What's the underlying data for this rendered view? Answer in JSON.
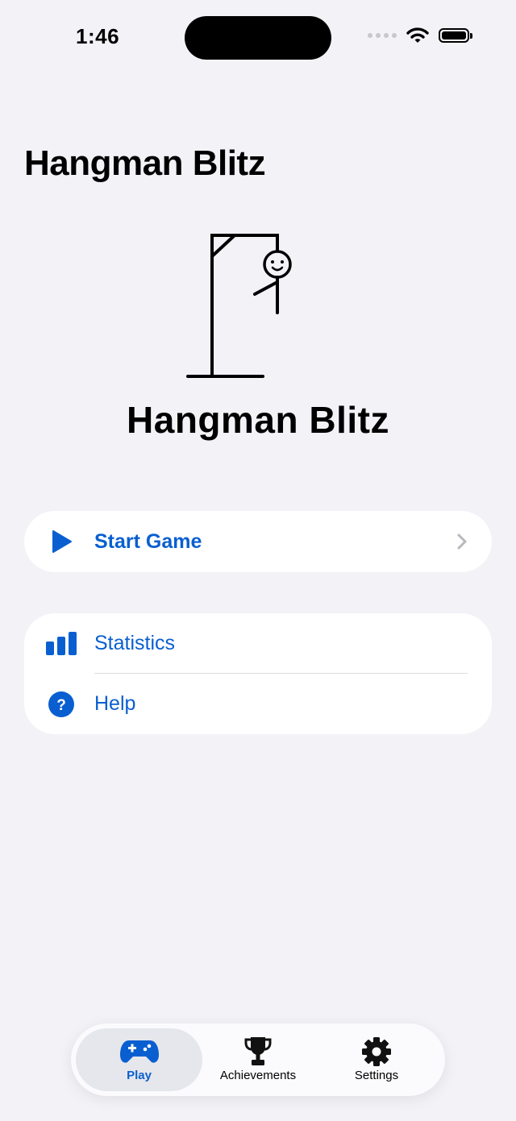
{
  "status": {
    "time": "1:46"
  },
  "header": {
    "title": "Hangman Blitz"
  },
  "logo": {
    "text": "Hangman Blitz"
  },
  "primary": {
    "start_label": "Start Game"
  },
  "menu": {
    "statistics_label": "Statistics",
    "help_label": "Help"
  },
  "tabs": {
    "play": "Play",
    "achievements": "Achievements",
    "settings": "Settings"
  },
  "colors": {
    "accent": "#0a5fd0",
    "background": "#f2f2f7"
  },
  "icons": {
    "start": "play-icon",
    "statistics": "bar-chart-icon",
    "help": "question-circle-icon",
    "play_tab": "gamecontroller-icon",
    "achievements_tab": "trophy-icon",
    "settings_tab": "gear-icon"
  }
}
